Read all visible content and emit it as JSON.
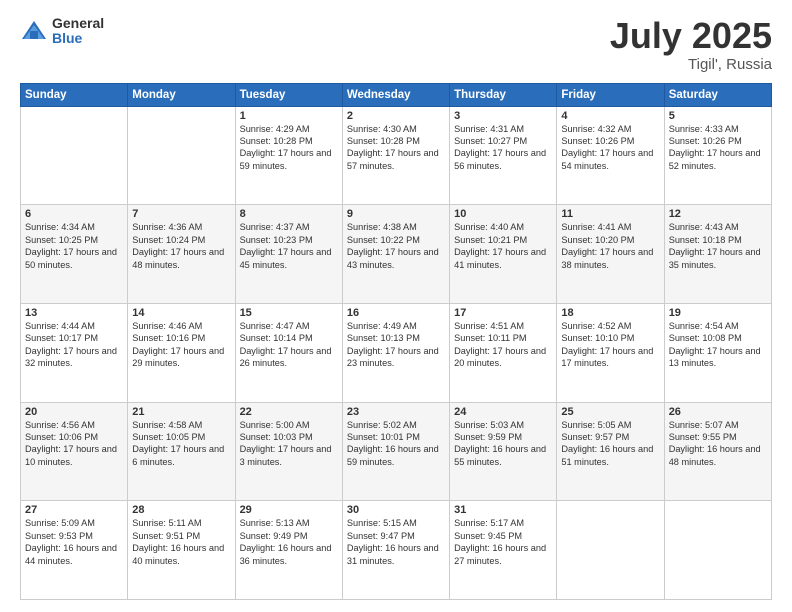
{
  "header": {
    "logo_general": "General",
    "logo_blue": "Blue",
    "title": "July 2025",
    "location": "Tigil', Russia"
  },
  "days_of_week": [
    "Sunday",
    "Monday",
    "Tuesday",
    "Wednesday",
    "Thursday",
    "Friday",
    "Saturday"
  ],
  "weeks": [
    [
      {
        "day": "",
        "info": ""
      },
      {
        "day": "",
        "info": ""
      },
      {
        "day": "1",
        "info": "Sunrise: 4:29 AM\nSunset: 10:28 PM\nDaylight: 17 hours and 59 minutes."
      },
      {
        "day": "2",
        "info": "Sunrise: 4:30 AM\nSunset: 10:28 PM\nDaylight: 17 hours and 57 minutes."
      },
      {
        "day": "3",
        "info": "Sunrise: 4:31 AM\nSunset: 10:27 PM\nDaylight: 17 hours and 56 minutes."
      },
      {
        "day": "4",
        "info": "Sunrise: 4:32 AM\nSunset: 10:26 PM\nDaylight: 17 hours and 54 minutes."
      },
      {
        "day": "5",
        "info": "Sunrise: 4:33 AM\nSunset: 10:26 PM\nDaylight: 17 hours and 52 minutes."
      }
    ],
    [
      {
        "day": "6",
        "info": "Sunrise: 4:34 AM\nSunset: 10:25 PM\nDaylight: 17 hours and 50 minutes."
      },
      {
        "day": "7",
        "info": "Sunrise: 4:36 AM\nSunset: 10:24 PM\nDaylight: 17 hours and 48 minutes."
      },
      {
        "day": "8",
        "info": "Sunrise: 4:37 AM\nSunset: 10:23 PM\nDaylight: 17 hours and 45 minutes."
      },
      {
        "day": "9",
        "info": "Sunrise: 4:38 AM\nSunset: 10:22 PM\nDaylight: 17 hours and 43 minutes."
      },
      {
        "day": "10",
        "info": "Sunrise: 4:40 AM\nSunset: 10:21 PM\nDaylight: 17 hours and 41 minutes."
      },
      {
        "day": "11",
        "info": "Sunrise: 4:41 AM\nSunset: 10:20 PM\nDaylight: 17 hours and 38 minutes."
      },
      {
        "day": "12",
        "info": "Sunrise: 4:43 AM\nSunset: 10:18 PM\nDaylight: 17 hours and 35 minutes."
      }
    ],
    [
      {
        "day": "13",
        "info": "Sunrise: 4:44 AM\nSunset: 10:17 PM\nDaylight: 17 hours and 32 minutes."
      },
      {
        "day": "14",
        "info": "Sunrise: 4:46 AM\nSunset: 10:16 PM\nDaylight: 17 hours and 29 minutes."
      },
      {
        "day": "15",
        "info": "Sunrise: 4:47 AM\nSunset: 10:14 PM\nDaylight: 17 hours and 26 minutes."
      },
      {
        "day": "16",
        "info": "Sunrise: 4:49 AM\nSunset: 10:13 PM\nDaylight: 17 hours and 23 minutes."
      },
      {
        "day": "17",
        "info": "Sunrise: 4:51 AM\nSunset: 10:11 PM\nDaylight: 17 hours and 20 minutes."
      },
      {
        "day": "18",
        "info": "Sunrise: 4:52 AM\nSunset: 10:10 PM\nDaylight: 17 hours and 17 minutes."
      },
      {
        "day": "19",
        "info": "Sunrise: 4:54 AM\nSunset: 10:08 PM\nDaylight: 17 hours and 13 minutes."
      }
    ],
    [
      {
        "day": "20",
        "info": "Sunrise: 4:56 AM\nSunset: 10:06 PM\nDaylight: 17 hours and 10 minutes."
      },
      {
        "day": "21",
        "info": "Sunrise: 4:58 AM\nSunset: 10:05 PM\nDaylight: 17 hours and 6 minutes."
      },
      {
        "day": "22",
        "info": "Sunrise: 5:00 AM\nSunset: 10:03 PM\nDaylight: 17 hours and 3 minutes."
      },
      {
        "day": "23",
        "info": "Sunrise: 5:02 AM\nSunset: 10:01 PM\nDaylight: 16 hours and 59 minutes."
      },
      {
        "day": "24",
        "info": "Sunrise: 5:03 AM\nSunset: 9:59 PM\nDaylight: 16 hours and 55 minutes."
      },
      {
        "day": "25",
        "info": "Sunrise: 5:05 AM\nSunset: 9:57 PM\nDaylight: 16 hours and 51 minutes."
      },
      {
        "day": "26",
        "info": "Sunrise: 5:07 AM\nSunset: 9:55 PM\nDaylight: 16 hours and 48 minutes."
      }
    ],
    [
      {
        "day": "27",
        "info": "Sunrise: 5:09 AM\nSunset: 9:53 PM\nDaylight: 16 hours and 44 minutes."
      },
      {
        "day": "28",
        "info": "Sunrise: 5:11 AM\nSunset: 9:51 PM\nDaylight: 16 hours and 40 minutes."
      },
      {
        "day": "29",
        "info": "Sunrise: 5:13 AM\nSunset: 9:49 PM\nDaylight: 16 hours and 36 minutes."
      },
      {
        "day": "30",
        "info": "Sunrise: 5:15 AM\nSunset: 9:47 PM\nDaylight: 16 hours and 31 minutes."
      },
      {
        "day": "31",
        "info": "Sunrise: 5:17 AM\nSunset: 9:45 PM\nDaylight: 16 hours and 27 minutes."
      },
      {
        "day": "",
        "info": ""
      },
      {
        "day": "",
        "info": ""
      }
    ]
  ]
}
